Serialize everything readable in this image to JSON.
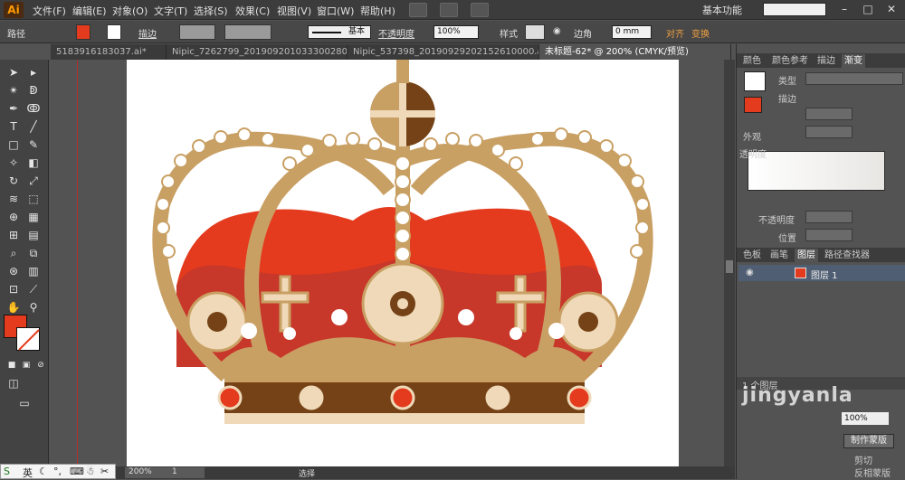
{
  "app": {
    "logo": "Ai"
  },
  "menu": [
    "文件(F)",
    "编辑(E)",
    "对象(O)",
    "文字(T)",
    "选择(S)",
    "效果(C)",
    "视图(V)",
    "窗口(W)",
    "帮助(H)"
  ],
  "menu_icons": [
    "bridge-icon",
    "arrange-documents-icon",
    "gpu-performance-icon"
  ],
  "workspace_label": "基本功能",
  "window_controls": [
    "–",
    "□",
    "✕"
  ],
  "control_bar": {
    "object_type": "路径",
    "fill_color": "#e43b1e",
    "stroke_label": "描边",
    "stroke_style": "基本",
    "opacity_label": "不透明度",
    "opacity_value": "100%",
    "style_label": "样式",
    "corner_label": "边角",
    "corner_value": "0 mm",
    "align_label": "对齐",
    "transform_label": "变换"
  },
  "doc_tabs": [
    {
      "label": "5183916183037.ai*",
      "active": false
    },
    {
      "label": "Nipic_7262799_20190920103330028031.ai*",
      "active": false
    },
    {
      "label": "Nipic_537398_20190929202152610000.ai*",
      "active": false
    },
    {
      "label": "未标题-62* @ 200% (CMYK/预览)",
      "active": true
    }
  ],
  "status": {
    "zoom": "200%",
    "page": "1",
    "tool": "选择"
  },
  "ime": {
    "label": "英"
  },
  "right_panel": {
    "top_tabs": [
      "颜色",
      "颜色参考",
      "描边",
      "渐变"
    ],
    "type_label": "类型",
    "stroke_label": "描边",
    "mid_tabs": [
      "外观",
      "透明度"
    ],
    "opacity_label": "不透明度",
    "position_label": "位置",
    "layer_tabs": [
      "色板",
      "画笔",
      "图层",
      "路径查找器"
    ],
    "layer_name": "图层 1",
    "layer_count": "1 个图层",
    "opacity_field": "100%",
    "make_mask": "制作蒙版",
    "clip_label": "剪切",
    "invert_label": "反相蒙版"
  },
  "colors": {
    "gold": "#c9a064",
    "gold_dark": "#a8854f",
    "red_light": "#e43b1e",
    "red_dark": "#c7372a",
    "brown": "#744216",
    "cream": "#efd9b8"
  },
  "watermark": "jingyanla"
}
